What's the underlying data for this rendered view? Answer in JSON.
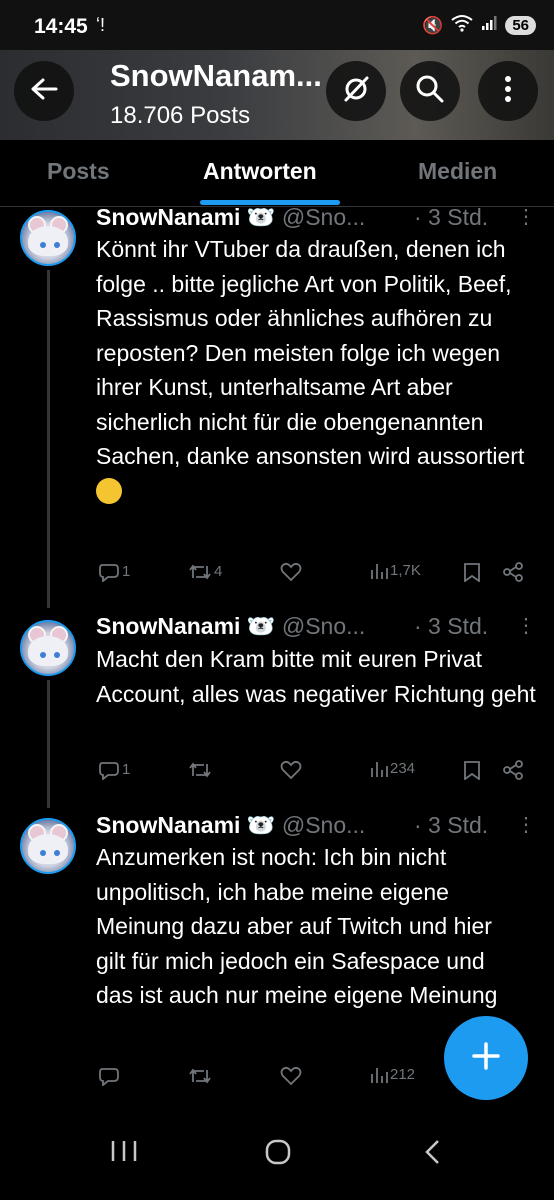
{
  "status_bar": {
    "time": "14:45",
    "battery": "56"
  },
  "header": {
    "title": "SnowNanam...",
    "subtitle": "18.706 Posts"
  },
  "tabs": [
    {
      "label": "Posts",
      "active": false
    },
    {
      "label": "Antworten",
      "active": true
    },
    {
      "label": "Medien",
      "active": false
    }
  ],
  "accent_color": "#1d9bf0",
  "tweets": [
    {
      "name": "SnowNanami",
      "handle": "@Sno...",
      "time": "· 3 Std.",
      "text": "Könnt ihr VTuber da draußen, denen ich folge .. bitte jegliche Art von Politik, Beef, Rassismus oder ähnliches aufhören zu reposten? Den meisten folge ich wegen ihrer Kunst, unterhaltsame Art aber sicherlich nicht für die obengenannten Sachen, danke ansonsten wird aussortiert",
      "replies": "1",
      "reposts": "4",
      "views": "1,7K"
    },
    {
      "name": "SnowNanami",
      "handle": "@Sno...",
      "time": "· 3 Std.",
      "text": "Macht den Kram bitte mit euren Privat Account, alles was negativer Richtung geht",
      "replies": "1",
      "reposts": "",
      "views": "234"
    },
    {
      "name": "SnowNanami",
      "handle": "@Sno...",
      "time": "· 3 Std.",
      "text": "Anzumerken ist noch: Ich bin nicht unpolitisch, ich habe meine eigene Meinung dazu aber auf Twitch und hier gilt für mich jedoch ein Safespace und das ist auch nur meine eigene Meinung",
      "replies": "",
      "reposts": "",
      "views": "212"
    }
  ]
}
